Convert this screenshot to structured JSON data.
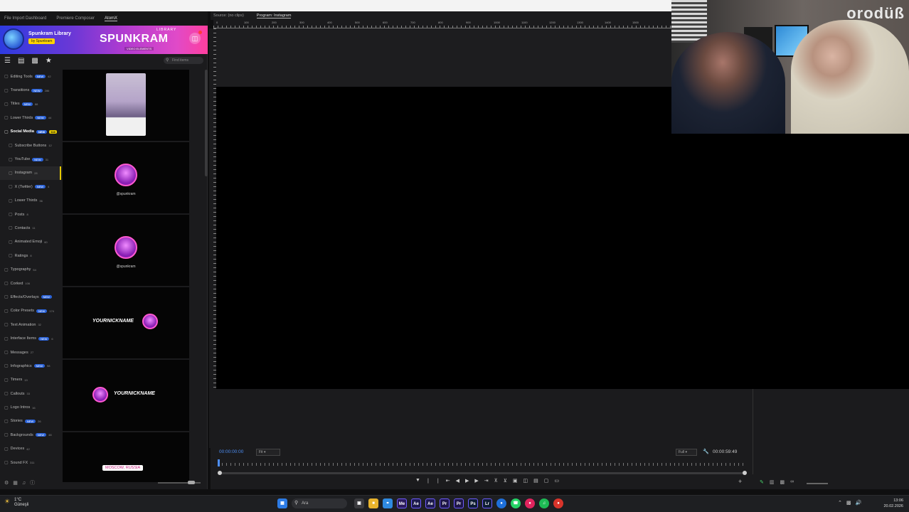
{
  "left_panel": {
    "tabs": [
      {
        "label": "File Import Dashboard"
      },
      {
        "label": "Premiere Composer"
      },
      {
        "label": "AtomX"
      }
    ],
    "banner": {
      "library_title": "Spunkram Library",
      "badge": "by Spunkram",
      "brand": "SPUNKRAM",
      "brand_top": "LIBRARY",
      "brand_bottom": "VIDEO ELEMENTS"
    },
    "search_placeholder": "Find items",
    "tree": [
      {
        "label": "Editing Tools",
        "pill": "NEW",
        "count": "42"
      },
      {
        "label": "Transitions",
        "pill": "NEW",
        "count": "286"
      },
      {
        "label": "Titles",
        "pill": "NEW",
        "count": "88"
      },
      {
        "label": "Lower Thirds",
        "pill": "NEW",
        "count": "44"
      },
      {
        "label": "Social Media",
        "pill": "NEW",
        "count": "116"
      },
      {
        "label": "Subscribe Buttons",
        "count": "12"
      },
      {
        "label": "YouTube",
        "pill": "NEW",
        "count": "31"
      },
      {
        "label": "Instagram",
        "count": "28"
      },
      {
        "label": "X (Twitter)",
        "pill": "NEW",
        "count": "4"
      },
      {
        "label": "Lower Thirds",
        "count": "36"
      },
      {
        "label": "Posts",
        "count": "8"
      },
      {
        "label": "Contacts",
        "count": "11"
      },
      {
        "label": "Animated Emoji",
        "count": "60"
      },
      {
        "label": "Ratings",
        "count": "8"
      },
      {
        "label": "Typography",
        "count": "54"
      },
      {
        "label": "Corked",
        "count": "106"
      },
      {
        "label": "Effects/Overlays",
        "pill": "NEW",
        "count": ""
      },
      {
        "label": "Color Presets",
        "pill": "NEW",
        "count": "174"
      },
      {
        "label": "Text Animation",
        "count": "32"
      },
      {
        "label": "Interface Items",
        "pill": "NEW",
        "count": "6"
      },
      {
        "label": "Messages",
        "count": "27"
      },
      {
        "label": "Infographics",
        "pill": "NEW",
        "count": "98"
      },
      {
        "label": "Timers",
        "count": "19"
      },
      {
        "label": "Callouts",
        "count": "33"
      },
      {
        "label": "Logo Intros",
        "count": "16"
      },
      {
        "label": "Stories",
        "pill": "NEW",
        "count": "26"
      },
      {
        "label": "Backgrounds",
        "pill": "NEW",
        "count": "48"
      },
      {
        "label": "Devices",
        "count": "42"
      },
      {
        "label": "Sound FX",
        "count": "311"
      }
    ],
    "thumbs": {
      "handle": "@spunkram",
      "nick": "YOURNICKNAME",
      "location_tag": "MOSCOW, RUSSIA"
    }
  },
  "monitor": {
    "tabs": [
      {
        "label": "Source: (no clips)"
      },
      {
        "label": "Program: Instagram"
      }
    ],
    "ruler_labels": [
      "0",
      "100",
      "200",
      "300",
      "400",
      "500",
      "600",
      "700",
      "800",
      "900",
      "1000",
      "1100",
      "1200",
      "1300",
      "1400",
      "1500"
    ],
    "timecode_left": "00:00:00:00",
    "fit": "Fit",
    "full": "Full",
    "timecode_right": "00:00:59:49"
  },
  "webcam": {
    "brand": "orodüß"
  },
  "taskbar": {
    "temp": "1°C",
    "weather": "Güneşli",
    "search": "Ara",
    "time": "13:06",
    "date": "20.02.2026",
    "apps": [
      {
        "label": "Me",
        "color": "#2b1a5c"
      },
      {
        "label": "Ae",
        "color": "#1d1a4e"
      },
      {
        "label": "Ae",
        "color": "#1d1a4e"
      },
      {
        "label": "Pr",
        "color": "#1e1648"
      },
      {
        "label": "Pr",
        "color": "#1e1648"
      },
      {
        "label": "Ps",
        "color": "#0d1c33"
      },
      {
        "label": "Lr",
        "color": "#0d1c33"
      }
    ]
  }
}
